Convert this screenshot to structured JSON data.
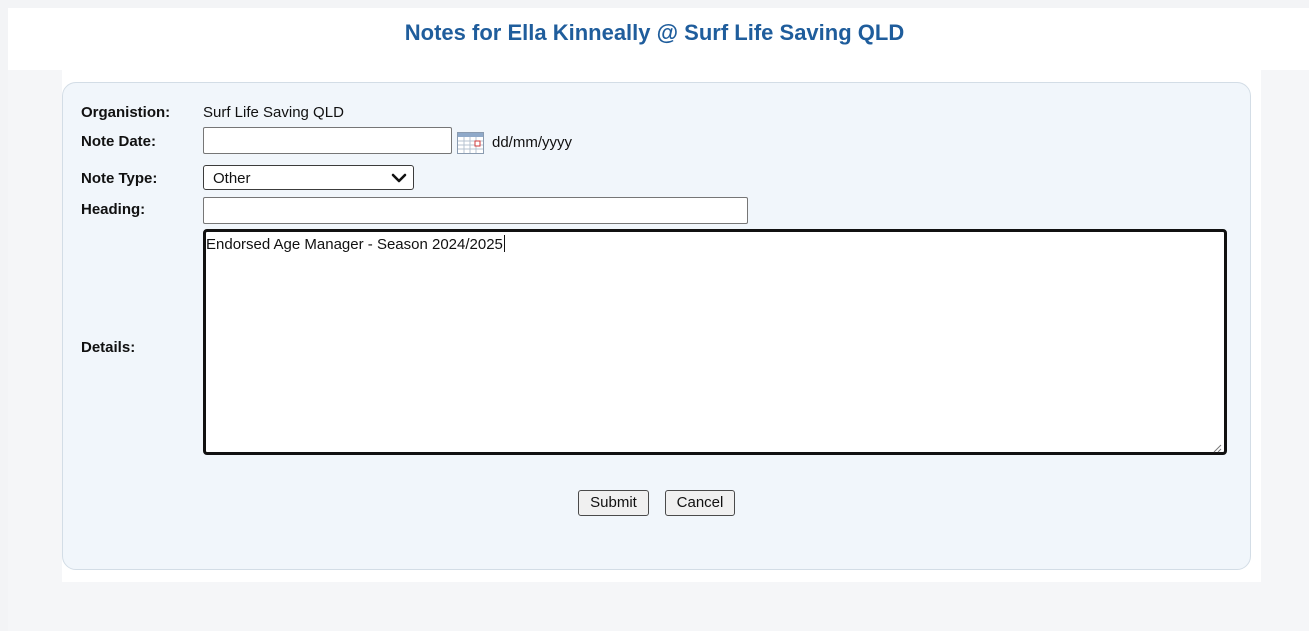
{
  "page": {
    "title": "Notes for Ella Kinneally @ Surf Life Saving QLD"
  },
  "form": {
    "organisation": {
      "label": "Organistion:",
      "value": "Surf Life Saving QLD"
    },
    "note_date": {
      "label": "Note Date:",
      "value": "",
      "format_hint": "dd/mm/yyyy",
      "icon": "calendar-icon"
    },
    "note_type": {
      "label": "Note Type:",
      "selected": "Other"
    },
    "heading": {
      "label": "Heading:",
      "value": ""
    },
    "details": {
      "label": "Details:",
      "value": "Endorsed Age Manager - Season 2024/2025"
    },
    "buttons": {
      "submit": "Submit",
      "cancel": "Cancel"
    }
  },
  "colors": {
    "title": "#1f5d9c",
    "panel_background": "#f1f6fb",
    "panel_border": "#d3dde6"
  }
}
